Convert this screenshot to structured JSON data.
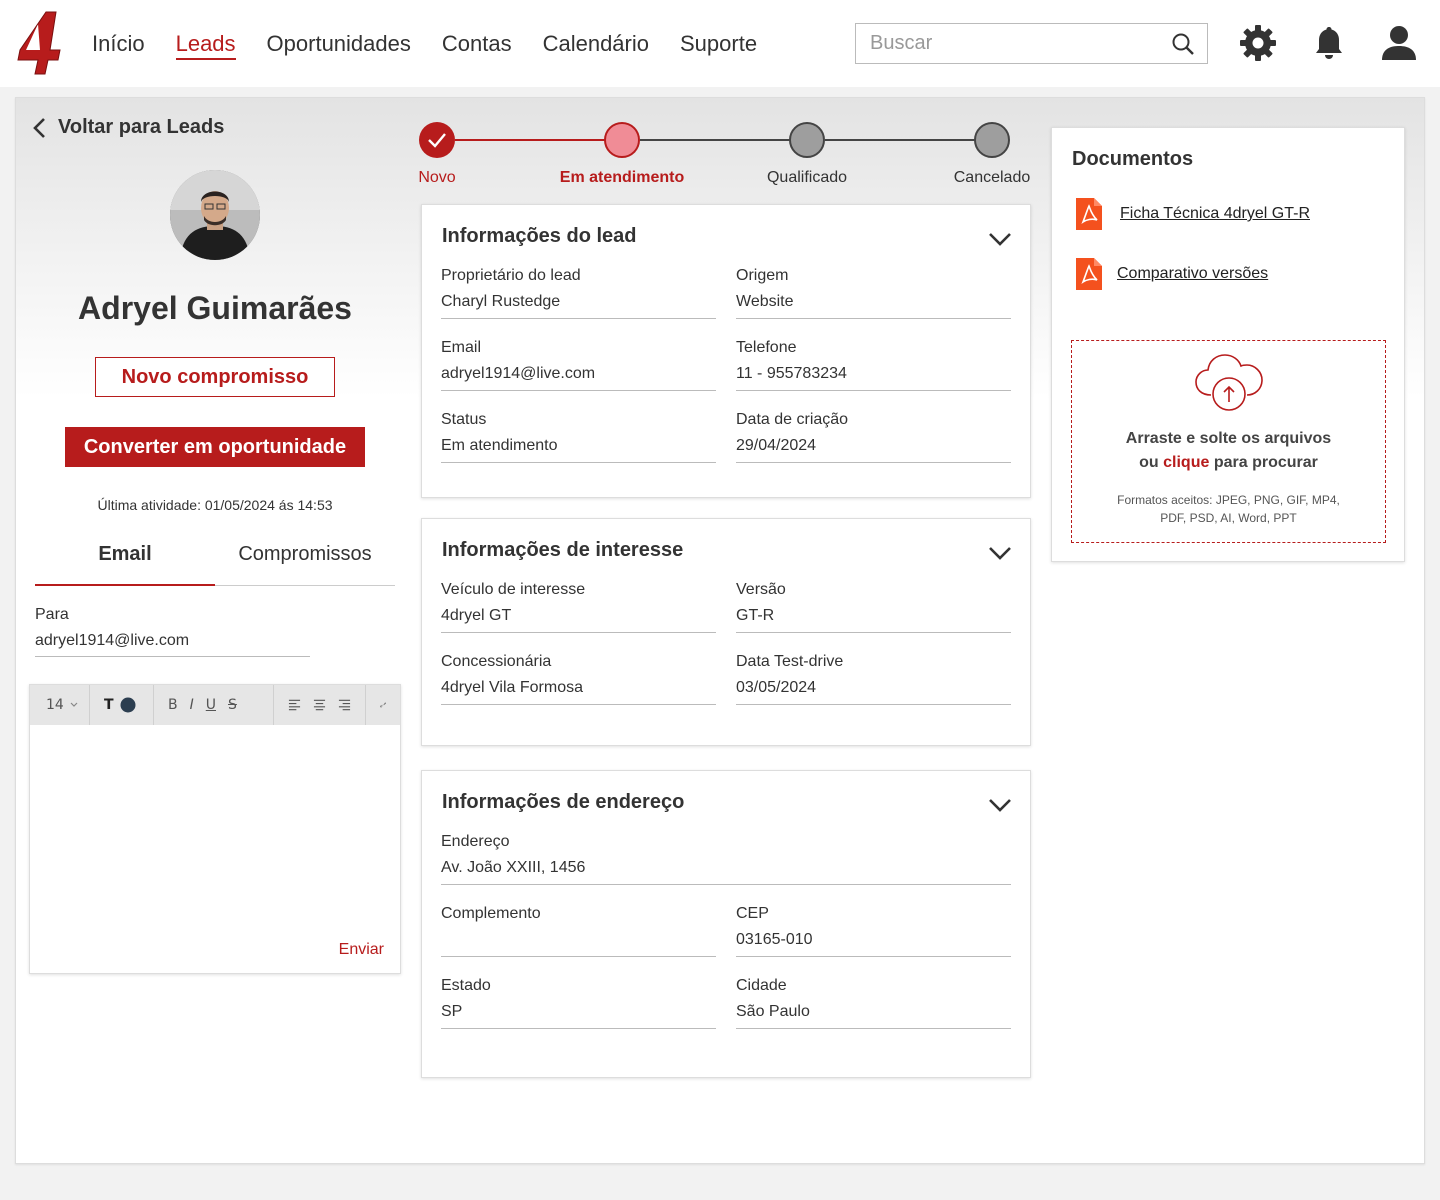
{
  "nav": {
    "logo_text": "4",
    "items": [
      {
        "label": "Início",
        "active": false
      },
      {
        "label": "Leads",
        "active": true
      },
      {
        "label": "Oportunidades",
        "active": false
      },
      {
        "label": "Contas",
        "active": false
      },
      {
        "label": "Calendário",
        "active": false
      },
      {
        "label": "Suporte",
        "active": false
      }
    ],
    "search_placeholder": "Buscar"
  },
  "left": {
    "back_label": "Voltar para Leads",
    "lead_name": "Adryel Guimarães",
    "new_appointment": "Novo compromisso",
    "convert": "Converter em oportunidade",
    "last_activity": "Última atividade: 01/05/2024 ás 14:53",
    "tabs": [
      {
        "label": "Email",
        "active": true
      },
      {
        "label": "Compromissos",
        "active": false
      }
    ],
    "to_label": "Para",
    "to_value": "adryel1914@live.com",
    "editor": {
      "font_size": "14",
      "send_label": "Enviar"
    }
  },
  "stepper": {
    "steps": [
      {
        "label": "Novo",
        "state": "done"
      },
      {
        "label": "Em atendimento",
        "state": "current"
      },
      {
        "label": "Qualificado",
        "state": "pending"
      },
      {
        "label": "Cancelado",
        "state": "pending"
      }
    ]
  },
  "lead_info": {
    "title": "Informações do lead",
    "owner_label": "Proprietário do lead",
    "owner": "Charyl Rustedge",
    "origin_label": "Origem",
    "origin": "Website",
    "email_label": "Email",
    "email": "adryel1914@live.com",
    "phone_label": "Telefone",
    "phone": "11 - 955783234",
    "status_label": "Status",
    "status": "Em atendimento",
    "created_label": "Data de criação",
    "created": "29/04/2024"
  },
  "interest_info": {
    "title": "Informações de interesse",
    "vehicle_label": "Veículo de interesse",
    "vehicle": "4dryel GT",
    "version_label": "Versão",
    "version": "GT-R",
    "dealer_label": "Concessionária",
    "dealer": "4dryel Vila Formosa",
    "testdrive_label": "Data Test-drive",
    "testdrive": "03/05/2024"
  },
  "address_info": {
    "title": "Informações de endereço",
    "address_label": "Endereço",
    "address": "Av. João XXIII, 1456",
    "complement_label": "Complemento",
    "complement": "",
    "cep_label": "CEP",
    "cep": "03165-010",
    "state_label": "Estado",
    "state": "SP",
    "city_label": "Cidade",
    "city": "São Paulo"
  },
  "documents": {
    "title": "Documentos",
    "files": [
      {
        "name": "Ficha Técnica 4dryel GT-R"
      },
      {
        "name": "Comparativo versões"
      }
    ],
    "dropzone": {
      "line1": "Arraste e solte os arquivos",
      "line2_pre": "ou ",
      "line2_link": "clique",
      "line2_post": " para procurar",
      "formats_line1": "Formatos aceitos: JPEG, PNG, GIF, MP4,",
      "formats_line2": "PDF, PSD, AI, Word, PPT"
    }
  },
  "colors": {
    "brand": "#b71c1c",
    "step_current": "#f08c96",
    "step_pending": "#9e9e9e"
  }
}
